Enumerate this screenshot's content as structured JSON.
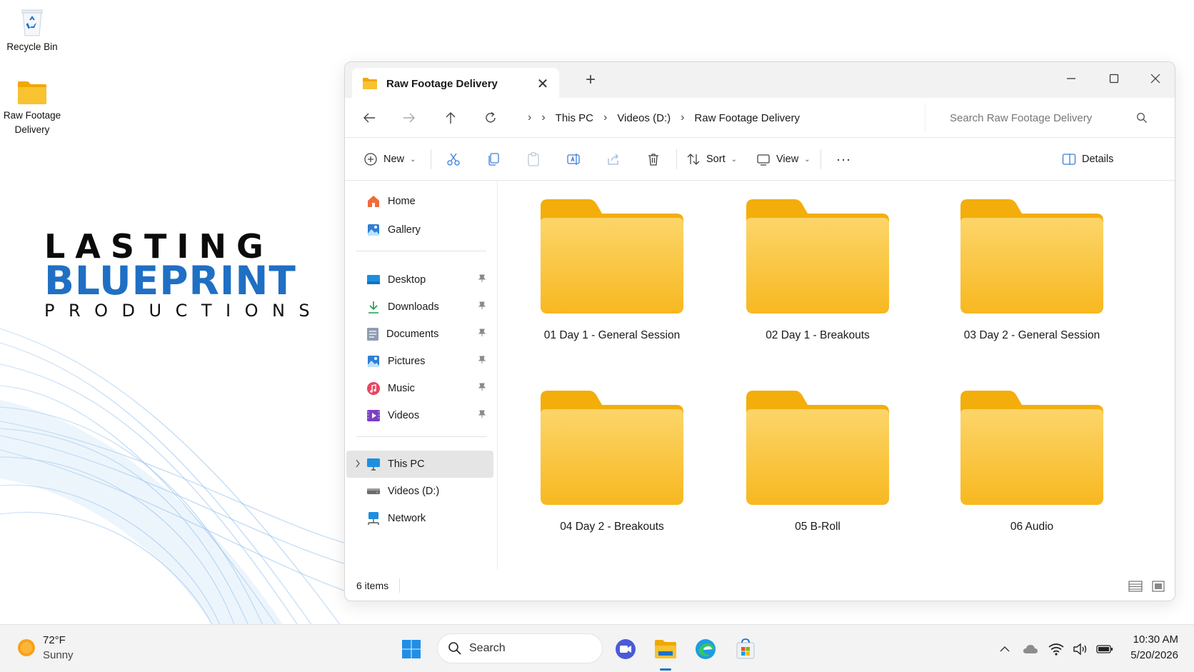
{
  "desktop": {
    "icons": [
      {
        "label": "Recycle Bin",
        "icon": "recycle-bin-icon"
      },
      {
        "label_line1": "Raw Footage",
        "label_line2": "Delivery",
        "icon": "folder-icon"
      }
    ],
    "logo": {
      "line1": "LASTING",
      "line2": "BLUEPRINT",
      "line3": "PRODUCTIONS",
      "accent": "#1f6fc4"
    }
  },
  "explorer": {
    "tab": {
      "title": "Raw Footage Delivery",
      "close": "✕"
    },
    "new_tab": "+",
    "breadcrumb": [
      "This PC",
      "Videos (D:)",
      "Raw Footage Delivery"
    ],
    "search": {
      "placeholder": "Search Raw Footage Delivery"
    },
    "commands": {
      "new": "New",
      "sort": "Sort",
      "view": "View",
      "more": "···",
      "details": "Details"
    },
    "nav": {
      "quick": [
        {
          "label": "Home"
        },
        {
          "label": "Gallery"
        }
      ],
      "pinned": [
        {
          "label": "Desktop"
        },
        {
          "label": "Downloads"
        },
        {
          "label": "Documents"
        },
        {
          "label": "Pictures"
        },
        {
          "label": "Music"
        },
        {
          "label": "Videos"
        }
      ],
      "devices": [
        {
          "label": "This PC",
          "selected": true
        },
        {
          "label": "Videos (D:)"
        },
        {
          "label": "Network"
        }
      ]
    },
    "folders": [
      {
        "name": "01 Day 1 - General Session"
      },
      {
        "name": "02 Day 1 - Breakouts"
      },
      {
        "name": "03 Day 2 - General Session"
      },
      {
        "name": "04 Day 2 - Breakouts"
      },
      {
        "name": "05 B-Roll"
      },
      {
        "name": "06 Audio"
      }
    ],
    "status": {
      "count": "6 items"
    }
  },
  "taskbar": {
    "weather": {
      "temp": "72°F",
      "condition": "Sunny"
    },
    "search_label": "Search",
    "pinned_apps": [
      "windows-start-icon",
      "video-call-icon",
      "file-explorer-icon",
      "edge-browser-icon",
      "store-icon"
    ],
    "clock": {
      "time": "10:30 AM",
      "date": "5/20/2026"
    }
  },
  "colors": {
    "folder": "#f9c230",
    "folder_dark": "#f0a800",
    "accent": "#1a73c9"
  }
}
